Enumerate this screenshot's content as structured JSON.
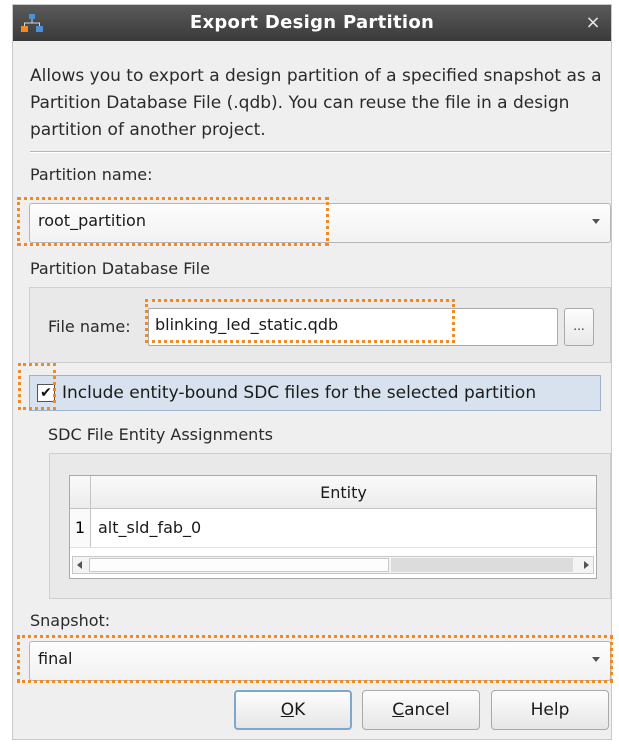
{
  "window": {
    "title": "Export Design Partition",
    "close_glyph": "×",
    "app_icon": "hierarchy-icon"
  },
  "description": "Allows you to export a design partition of a specified snapshot as a Partition Database File (.qdb). You can reuse the file in a design partition of another project.",
  "partition": {
    "label": "Partition name:",
    "value": "root_partition"
  },
  "database_file": {
    "group_label": "Partition Database File",
    "file_label": "File name:",
    "file_value": "blinking_led_static.qdb",
    "browse_label": "..."
  },
  "include_sdc": {
    "checked": true,
    "check_glyph": "✔",
    "label": "Include entity-bound SDC files for the selected partition"
  },
  "sdc_assignments": {
    "label": "SDC File Entity Assignments",
    "columns": [
      "Entity"
    ],
    "rows": [
      {
        "num": "1",
        "entity": "alt_sld_fab_0"
      }
    ]
  },
  "snapshot": {
    "label": "Snapshot:",
    "value": "final"
  },
  "buttons": {
    "ok_mnemonic": "O",
    "ok_rest": "K",
    "cancel_mnemonic": "C",
    "cancel_rest": "ancel",
    "help": "Help"
  },
  "colors": {
    "highlight": "#f08a24",
    "titlebar": "#4a4a4a",
    "selection": "#d7e2ee"
  }
}
